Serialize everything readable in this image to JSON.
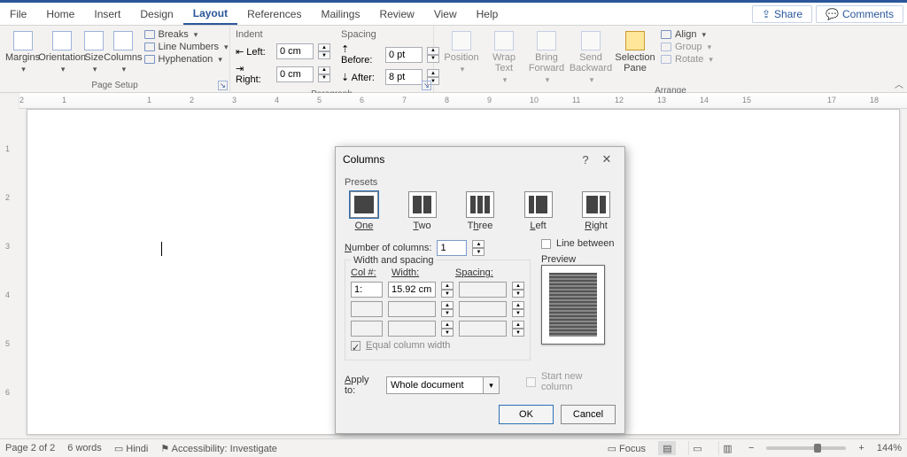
{
  "tabs": [
    "File",
    "Home",
    "Insert",
    "Design",
    "Layout",
    "References",
    "Mailings",
    "Review",
    "View",
    "Help"
  ],
  "active_tab": "Layout",
  "share": "Share",
  "comments": "Comments",
  "ribbon": {
    "page_setup": {
      "margins": "Margins",
      "orientation": "Orientation",
      "size": "Size",
      "columns": "Columns",
      "breaks": "Breaks",
      "line_numbers": "Line Numbers",
      "hyphenation": "Hyphenation",
      "label": "Page Setup"
    },
    "paragraph": {
      "indent": "Indent",
      "left": "Left:",
      "left_val": "0 cm",
      "right": "Right:",
      "right_val": "0 cm",
      "spacing": "Spacing",
      "before": "Before:",
      "before_val": "0 pt",
      "after": "After:",
      "after_val": "8 pt",
      "label": "Paragraph"
    },
    "arrange": {
      "position": "Position",
      "wrap": "Wrap Text",
      "bring": "Bring Forward",
      "send": "Send Backward",
      "selection": "Selection Pane",
      "align": "Align",
      "group": "Group",
      "rotate": "Rotate",
      "label": "Arrange"
    }
  },
  "ruler_numbers": [
    "2",
    "1",
    "",
    "1",
    "2",
    "3",
    "4",
    "5",
    "6",
    "7",
    "8",
    "9",
    "10",
    "11",
    "12",
    "13",
    "14",
    "15",
    "",
    "17",
    "18"
  ],
  "vruler_numbers": [
    "1",
    "2",
    "3",
    "4",
    "5",
    "6"
  ],
  "dialog": {
    "title": "Columns",
    "presets_label": "Presets",
    "presets": [
      "One",
      "Two",
      "Three",
      "Left",
      "Right"
    ],
    "num_cols_label": "Number of columns:",
    "num_cols": "1",
    "line_between": "Line between",
    "width_spacing": "Width and spacing",
    "col_hdr": "Col #:",
    "width_hdr": "Width:",
    "spacing_hdr": "Spacing:",
    "col1": "1:",
    "width1": "15.92 cm",
    "equal": "Equal column width",
    "preview": "Preview",
    "apply_to": "Apply to:",
    "apply_val": "Whole document",
    "start_new": "Start new column",
    "ok": "OK",
    "cancel": "Cancel"
  },
  "status": {
    "page": "Page 2 of 2",
    "words": "6 words",
    "lang": "Hindi",
    "access": "Accessibility: Investigate",
    "focus": "Focus",
    "zoom": "144%"
  }
}
